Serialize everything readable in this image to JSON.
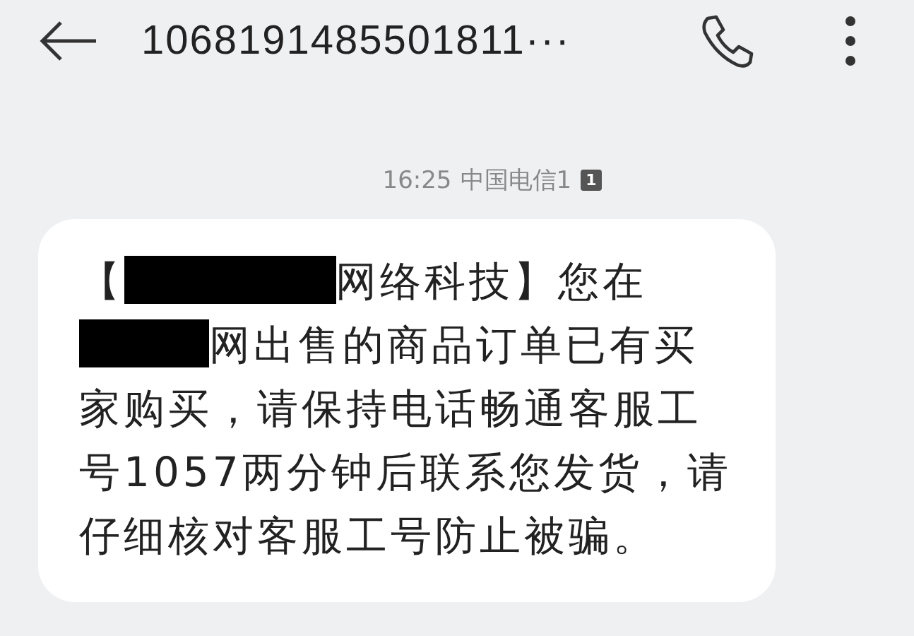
{
  "header": {
    "title": "1068191485501811···"
  },
  "timestamp": {
    "time": "16:25",
    "carrier": "中国电信1",
    "sim_badge": "1"
  },
  "message": {
    "lines": [
      [
        {
          "kind": "text",
          "text": "【"
        },
        {
          "kind": "redacted"
        },
        {
          "kind": "text",
          "text": "网络科技】您在"
        }
      ],
      [
        {
          "kind": "redacted"
        },
        {
          "kind": "text",
          "text": "网出售的商品订单已有买"
        }
      ],
      [
        {
          "kind": "text",
          "text": "家购买，请保持电话畅通客服工"
        }
      ],
      [
        {
          "kind": "text",
          "text": "号1057两分钟后联系您发货，请"
        }
      ],
      [
        {
          "kind": "text",
          "text": "仔细核对客服工号防止被骗。"
        }
      ]
    ]
  }
}
